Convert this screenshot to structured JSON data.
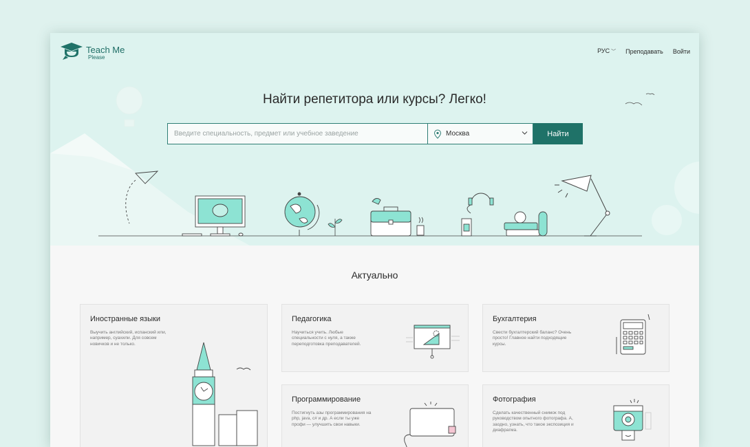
{
  "brand": {
    "name_main": "Teach Me",
    "name_sub": "Please"
  },
  "nav": {
    "lang": "РУС",
    "teach": "Преподавать",
    "login": "Войти"
  },
  "hero": {
    "title": "Найти репетитора или курсы? Легко!"
  },
  "search": {
    "placeholder": "Введите специальность, предмет или учебное заведение",
    "city": "Москва",
    "button": "Найти"
  },
  "section": {
    "title": "Актуально"
  },
  "cards": [
    {
      "title": "Иностранные языки",
      "text": "Выучить английский, испанский или, например, суахили. Для совсем новичков и не только."
    },
    {
      "title": "Педагогика",
      "text": "Научиться учить. Любые специальности с нуля, а также переподготовка преподавателей."
    },
    {
      "title": "Бухгалтерия",
      "text": "Свести бухгалтерский баланс? Очень просто! Главное найти подходящие курсы."
    },
    {
      "title": "Программирование",
      "text": "Постигнуть азы программирования на php, java, c# и др. А если ты уже профи — улучшить свои навыки."
    },
    {
      "title": "Фотография",
      "text": "Сделать качественный снимок под руководством опытного фотографа. А, заодно, узнать, что такое экспозиция и диафрагма."
    }
  ],
  "icons": {
    "logo": "graduation-cap-chat-icon",
    "location": "map-pin-icon",
    "dropdown": "chevron-down-icon"
  },
  "colors": {
    "accent": "#1f7268",
    "hero_bg": "#ddf3ef",
    "mint": "#8de3d3"
  }
}
